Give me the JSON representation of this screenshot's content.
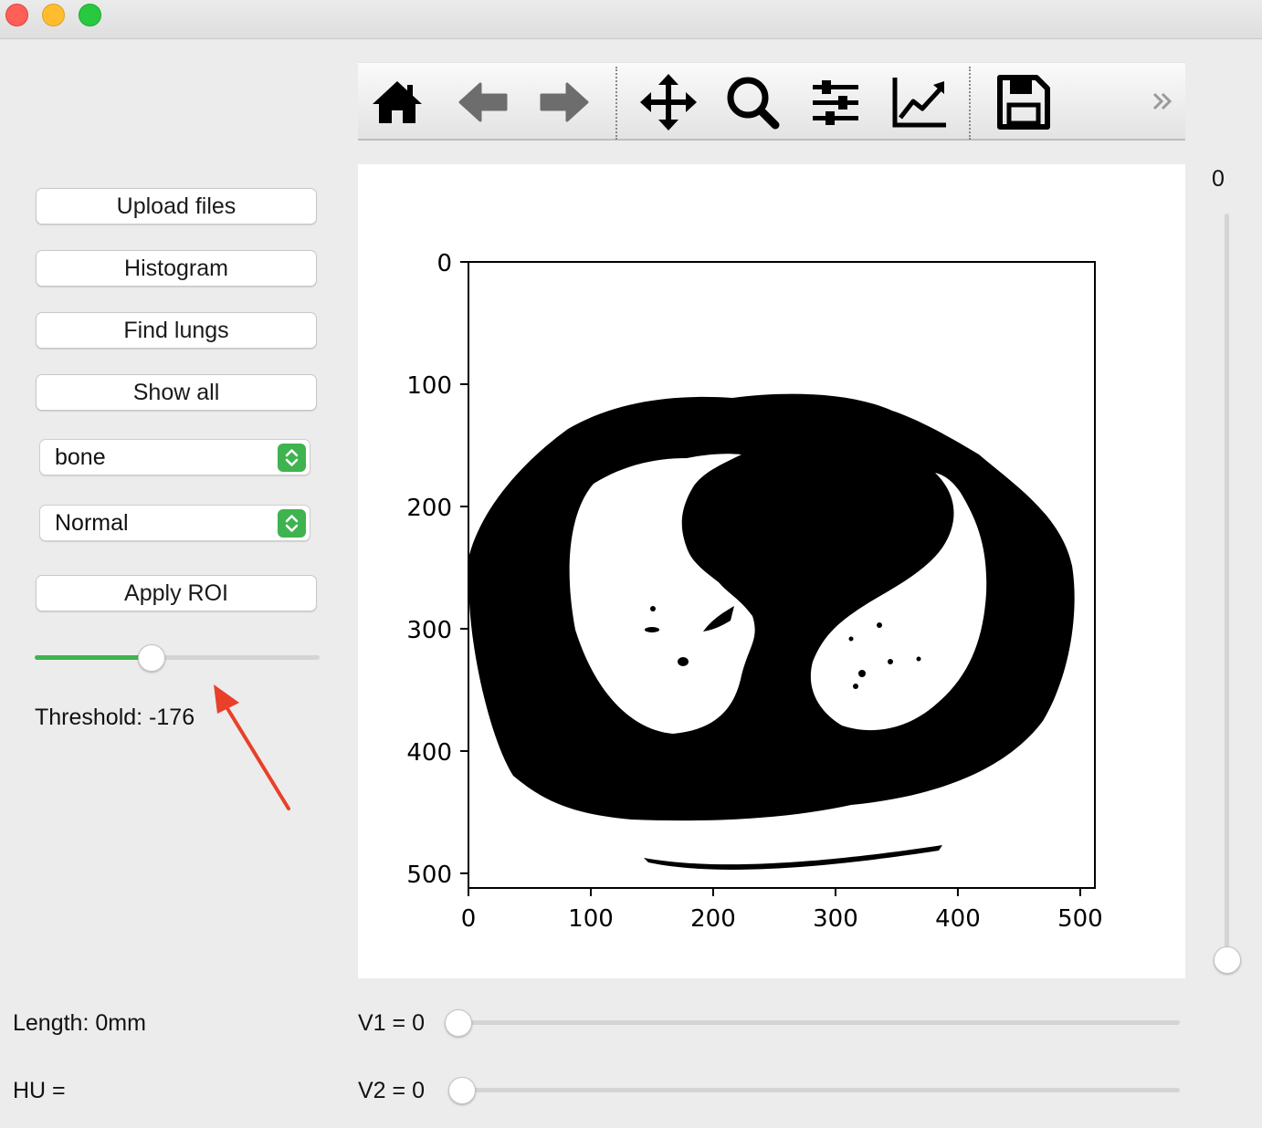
{
  "window": {
    "controls": [
      "close",
      "minimize",
      "zoom"
    ]
  },
  "sidebar": {
    "buttons": {
      "upload": "Upload files",
      "histogram": "Histogram",
      "find_lungs": "Find lungs",
      "show_all": "Show all",
      "apply_roi": "Apply ROI"
    },
    "colormap_select": {
      "value": "bone"
    },
    "mode_select": {
      "value": "Normal"
    },
    "threshold_slider": {
      "fraction": 0.4
    },
    "threshold_label": "Threshold: -176"
  },
  "toolbar": {
    "icons": [
      "home-icon",
      "back-arrow-icon",
      "forward-arrow-icon",
      "pan-move-icon",
      "zoom-magnifier-icon",
      "configure-subplots-icon",
      "edit-axis-icon",
      "save-icon",
      "overflow-chevron-icon"
    ]
  },
  "plot": {
    "x_ticks": [
      "0",
      "100",
      "200",
      "300",
      "400",
      "500"
    ],
    "y_ticks": [
      "0",
      "100",
      "200",
      "300",
      "400",
      "500"
    ],
    "xlim": [
      0,
      512
    ],
    "ylim": [
      512,
      0
    ],
    "image": "binary thresholded CT axial slice (black body, white lungs)"
  },
  "slice_slider": {
    "value_label": "0",
    "fraction": 0.0
  },
  "bottom": {
    "length_label": "Length: 0mm",
    "hu_label": "HU =",
    "v1_label": "V1 = 0",
    "v2_label": "V2 = 0",
    "v1_fraction": 0.0,
    "v2_fraction": 0.0
  },
  "colors": {
    "accent_green": "#3fb34f",
    "annotation_arrow": "#e8402a"
  }
}
